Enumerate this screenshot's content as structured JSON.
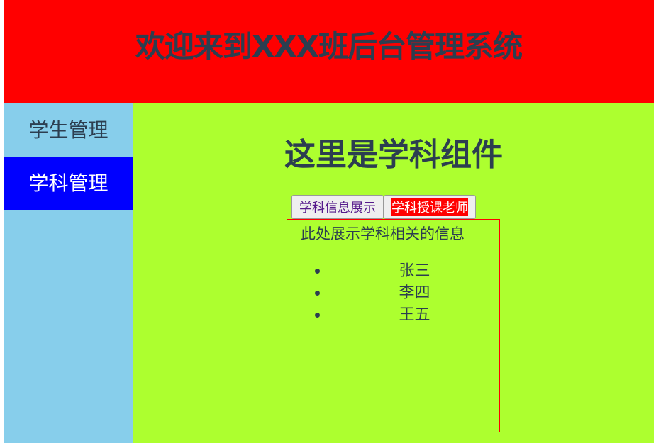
{
  "header": {
    "title": "欢迎来到XXX班后台管理系统"
  },
  "sidebar": {
    "items": [
      {
        "label": "学生管理",
        "active": false
      },
      {
        "label": "学科管理",
        "active": true
      }
    ]
  },
  "main": {
    "heading": "这里是学科组件",
    "tabs": [
      {
        "label": "学科信息展示"
      },
      {
        "label": "学科授课老师"
      }
    ],
    "panel": {
      "description": "此处展示学科相关的信息",
      "teachers": [
        "张三",
        "李四",
        "王五"
      ]
    }
  },
  "colors": {
    "header_bg": "#ff0000",
    "sidebar_bg": "#87ceeb",
    "active_nav_bg": "#0000ff",
    "main_bg": "#adff2f",
    "text": "#2c3e50",
    "panel_border": "#ff0000"
  }
}
